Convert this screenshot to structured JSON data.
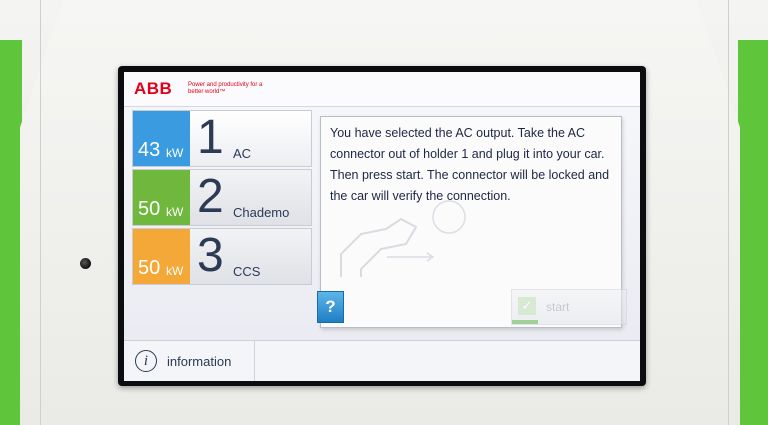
{
  "brand": {
    "logo": "ABB",
    "tagline": "Power and productivity for a better world™"
  },
  "outputs": [
    {
      "power": "43",
      "unit": "kW",
      "index": "1",
      "name": "AC",
      "color": "#3a9be0",
      "selected": true
    },
    {
      "power": "50",
      "unit": "kW",
      "index": "2",
      "name": "Chademo",
      "color": "#6fb83d",
      "selected": false
    },
    {
      "power": "50",
      "unit": "kW",
      "index": "3",
      "name": "CCS",
      "color": "#f3a838",
      "selected": false
    }
  ],
  "dialog": {
    "message": "You have selected the AC output. Take the AC connector out of holder 1 and plug it into your car. Then press start. The connector will be locked and the car will verify the connection.",
    "help_label": "?",
    "start_label": "start",
    "start_icon": "check-icon"
  },
  "footer": {
    "info_label": "information",
    "info_icon": "info-icon"
  }
}
